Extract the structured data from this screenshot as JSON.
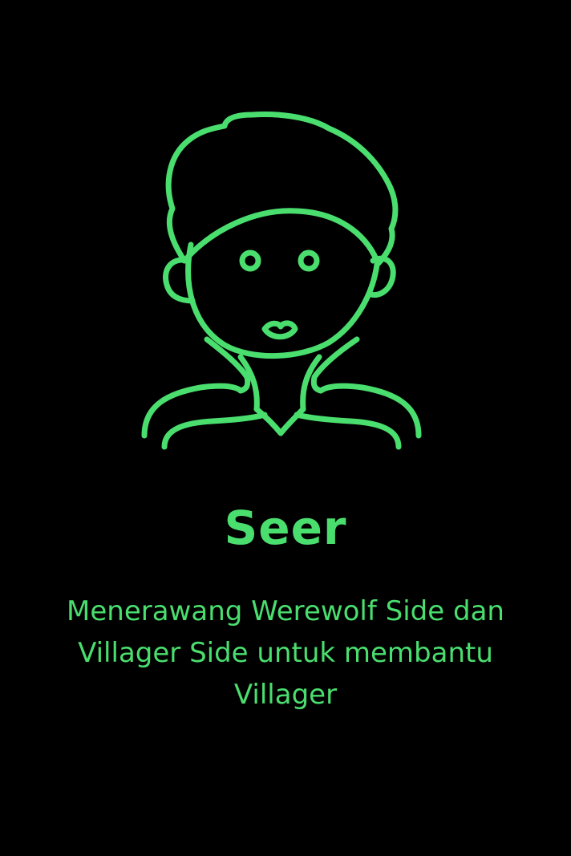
{
  "card": {
    "role_name": "Seer",
    "description": "Menerawang Werewolf Side dan Villager Side untuk membantu Villager",
    "portrait_icon": "seer-portrait-icon",
    "accent_color": "#4ade6e",
    "background_color": "#000000"
  }
}
